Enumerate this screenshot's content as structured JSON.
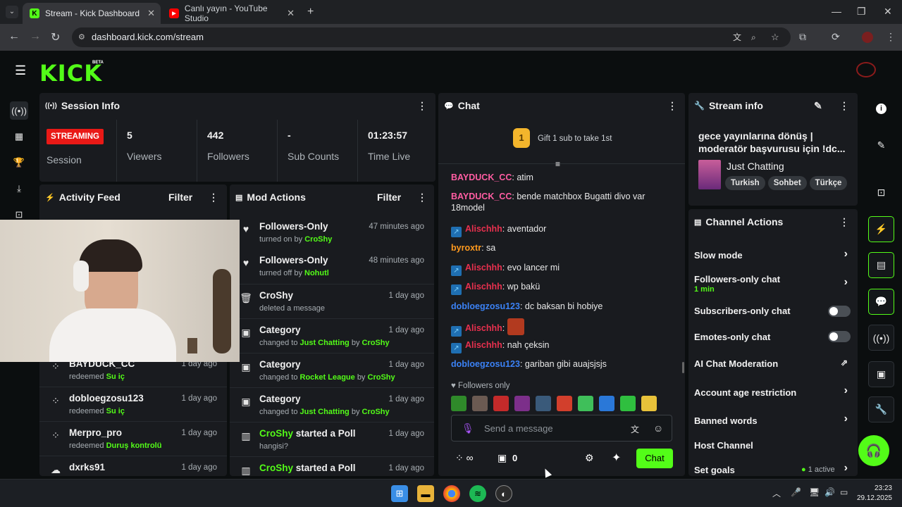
{
  "browser": {
    "tabs": [
      {
        "title": "Stream - Kick Dashboard",
        "icon": "kick-favicon"
      },
      {
        "title": "Canlı yayın - YouTube Studio",
        "icon": "youtube-favicon"
      }
    ],
    "url": "dashboard.kick.com/stream"
  },
  "kick": {
    "logo": "KICK",
    "beta": "BETA"
  },
  "session": {
    "title": "Session Info",
    "status_badge": "STREAMING",
    "session_label": "Session",
    "stats": [
      {
        "value": "5",
        "label": "Viewers"
      },
      {
        "value": "442",
        "label": "Followers"
      },
      {
        "value": "-",
        "label": "Sub Counts"
      },
      {
        "value": "01:23:57",
        "label": "Time Live"
      }
    ]
  },
  "activity": {
    "title": "Activity Feed",
    "filter": "Filter",
    "items": [
      {
        "user": "BAYDUCK_CC",
        "action": "redeemed",
        "reward": "Su iç",
        "time": "1 day ago"
      },
      {
        "user": "dobloegzosu123",
        "action": "redeemed",
        "reward": "Su iç",
        "time": "1 day ago"
      },
      {
        "user": "Merpro_pro",
        "action": "redeemed",
        "reward": "Duruş kontrolü",
        "time": "1 day ago"
      },
      {
        "user": "dxrks91",
        "action": "",
        "reward": "",
        "time": "1 day ago"
      }
    ]
  },
  "mod": {
    "title": "Mod Actions",
    "filter": "Filter",
    "items": [
      {
        "title": "Followers-Only",
        "pre": "turned on by",
        "hl": "CroShy",
        "post": "",
        "time": "47 minutes ago",
        "icon": "heart-icon"
      },
      {
        "title": "Followers-Only",
        "pre": "turned off by",
        "hl": "Nohutl",
        "post": "",
        "time": "48 minutes ago",
        "icon": "heart-icon"
      },
      {
        "title": "CroShy",
        "pre": "deleted a message",
        "hl": "",
        "post": "",
        "time": "1 day ago",
        "icon": "trash-icon"
      },
      {
        "title": "Category",
        "pre": "changed to",
        "hl": "Just Chatting",
        "post": "CroShy",
        "time": "1 day ago",
        "icon": "category-icon"
      },
      {
        "title": "Category",
        "pre": "changed to",
        "hl": "Rocket League",
        "post": "CroShy",
        "time": "1 day ago",
        "icon": "category-icon"
      },
      {
        "title": "Category",
        "pre": "changed to",
        "hl": "Just Chatting",
        "post": "CroShy",
        "time": "1 day ago",
        "icon": "category-icon"
      },
      {
        "title": "CroShy",
        "titlesuffix": "started a Poll",
        "pre": "hangisi?",
        "hl": "",
        "post": "",
        "time": "1 day ago",
        "icon": "poll-icon"
      },
      {
        "title": "CroShy",
        "titlesuffix": "started a Poll",
        "pre": "",
        "hl": "",
        "post": "",
        "time": "1 day ago",
        "icon": "poll-icon"
      }
    ],
    "by": "by"
  },
  "chat": {
    "title": "Chat",
    "gift_rank": "1",
    "gift_text": "Gift 1 sub to take 1st",
    "messages": [
      {
        "user": "BAYDUCK_CC",
        "color": "#ff5da2",
        "text": "atim",
        "badge": false
      },
      {
        "user": "BAYDUCK_CC",
        "color": "#ff5da2",
        "text": "bende matchbox Bugatti divo var",
        "text2": "18model",
        "badge": false
      },
      {
        "user": "Alischhh",
        "color": "#e8304e",
        "text": "aventador",
        "badge": true
      },
      {
        "user": "byroxtr",
        "color": "#ff9a1f",
        "text": "sa",
        "badge": false
      },
      {
        "user": "Alischhh",
        "color": "#e8304e",
        "text": "evo lancer mi",
        "badge": true
      },
      {
        "user": "Alischhh",
        "color": "#e8304e",
        "text": "wp bakü",
        "badge": true
      },
      {
        "user": "dobloegzosu123",
        "color": "#3b82f6",
        "text": "dc baksan bi hobiye",
        "badge": false
      },
      {
        "user": "Alischhh",
        "color": "#e8304e",
        "text": "",
        "badge": true,
        "emote": true
      },
      {
        "user": "Alischhh",
        "color": "#e8304e",
        "text": "nah çeksin",
        "badge": true
      },
      {
        "user": "dobloegzosu123",
        "color": "#3b82f6",
        "text": "gariban gibi auajsjsjs",
        "badge": false
      }
    ],
    "mode": "Followers only",
    "placeholder": "Send a message",
    "points": "0",
    "send": "Chat"
  },
  "stream_info": {
    "title": "Stream info",
    "stream_title_line1": "gece yayınlarına dönüş |",
    "stream_title_line2": "moderatör başvurusu için !dc...",
    "category": "Just Chatting",
    "tags": [
      "Turkish",
      "Sohbet",
      "Türkçe"
    ]
  },
  "channel_actions": {
    "title": "Channel Actions",
    "items": [
      {
        "label": "Slow mode",
        "kind": "chevron"
      },
      {
        "label": "Followers-only chat",
        "sub": "1 min",
        "kind": "chevron"
      },
      {
        "label": "Subscribers-only chat",
        "kind": "toggle"
      },
      {
        "label": "Emotes-only chat",
        "kind": "toggle"
      },
      {
        "label": "AI Chat Moderation",
        "kind": "external"
      },
      {
        "label": "Account age restriction",
        "kind": "chevron"
      },
      {
        "label": "Banned words",
        "kind": "chevron"
      },
      {
        "label": "Host Channel",
        "kind": "none"
      },
      {
        "label": "Set goals",
        "status": "1 active",
        "kind": "chevron"
      }
    ]
  },
  "taskbar": {
    "time": "23:23",
    "date": "29.12.2025"
  },
  "colors": {
    "accent": "#53fc18",
    "panel": "#191b1f",
    "bg": "#0b0e0f",
    "live": "#e91916"
  }
}
